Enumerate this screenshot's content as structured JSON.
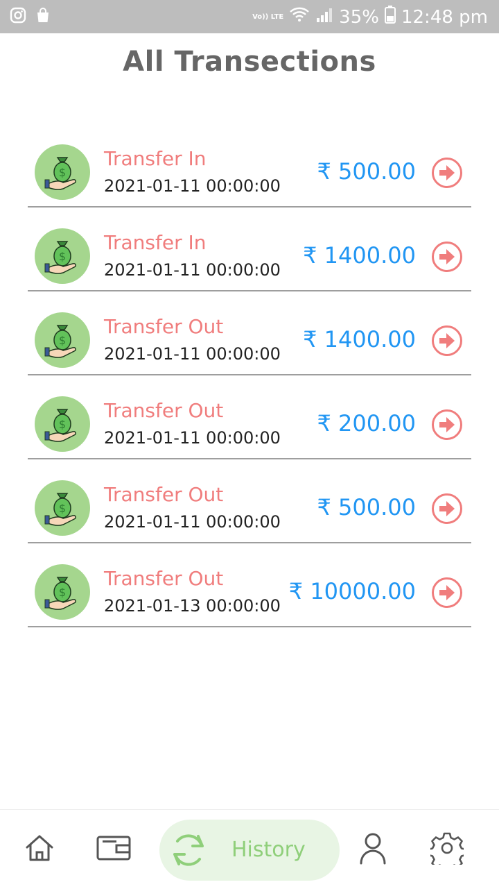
{
  "status_bar": {
    "network": "Vo)) LTE",
    "battery": "35%",
    "time": "12:48 pm"
  },
  "page": {
    "title": "All Transections"
  },
  "transactions": [
    {
      "type": "Transfer In",
      "date": "2021-01-11 00:00:00",
      "amount": "₹ 500.00"
    },
    {
      "type": "Transfer In",
      "date": "2021-01-11 00:00:00",
      "amount": "₹ 1400.00"
    },
    {
      "type": "Transfer Out",
      "date": "2021-01-11 00:00:00",
      "amount": "₹ 1400.00"
    },
    {
      "type": "Transfer Out",
      "date": "2021-01-11 00:00:00",
      "amount": "₹ 200.00"
    },
    {
      "type": "Transfer Out",
      "date": "2021-01-11 00:00:00",
      "amount": "₹ 500.00"
    },
    {
      "type": "Transfer Out",
      "date": "2021-01-13 00:00:00",
      "amount": "₹ 10000.00"
    }
  ],
  "bottom_nav": {
    "items": [
      {
        "icon": "home-icon"
      },
      {
        "icon": "wallet-icon"
      },
      {
        "icon": "refresh-icon",
        "label": "History",
        "active": true
      },
      {
        "icon": "user-icon"
      },
      {
        "icon": "gear-icon"
      }
    ]
  },
  "colors": {
    "status_bar": "#bdbdbd",
    "accent_red": "#f07d7d",
    "amount_blue": "#2196f3",
    "avatar_green": "#a5d68e",
    "active_green": "#8fcf7a"
  }
}
